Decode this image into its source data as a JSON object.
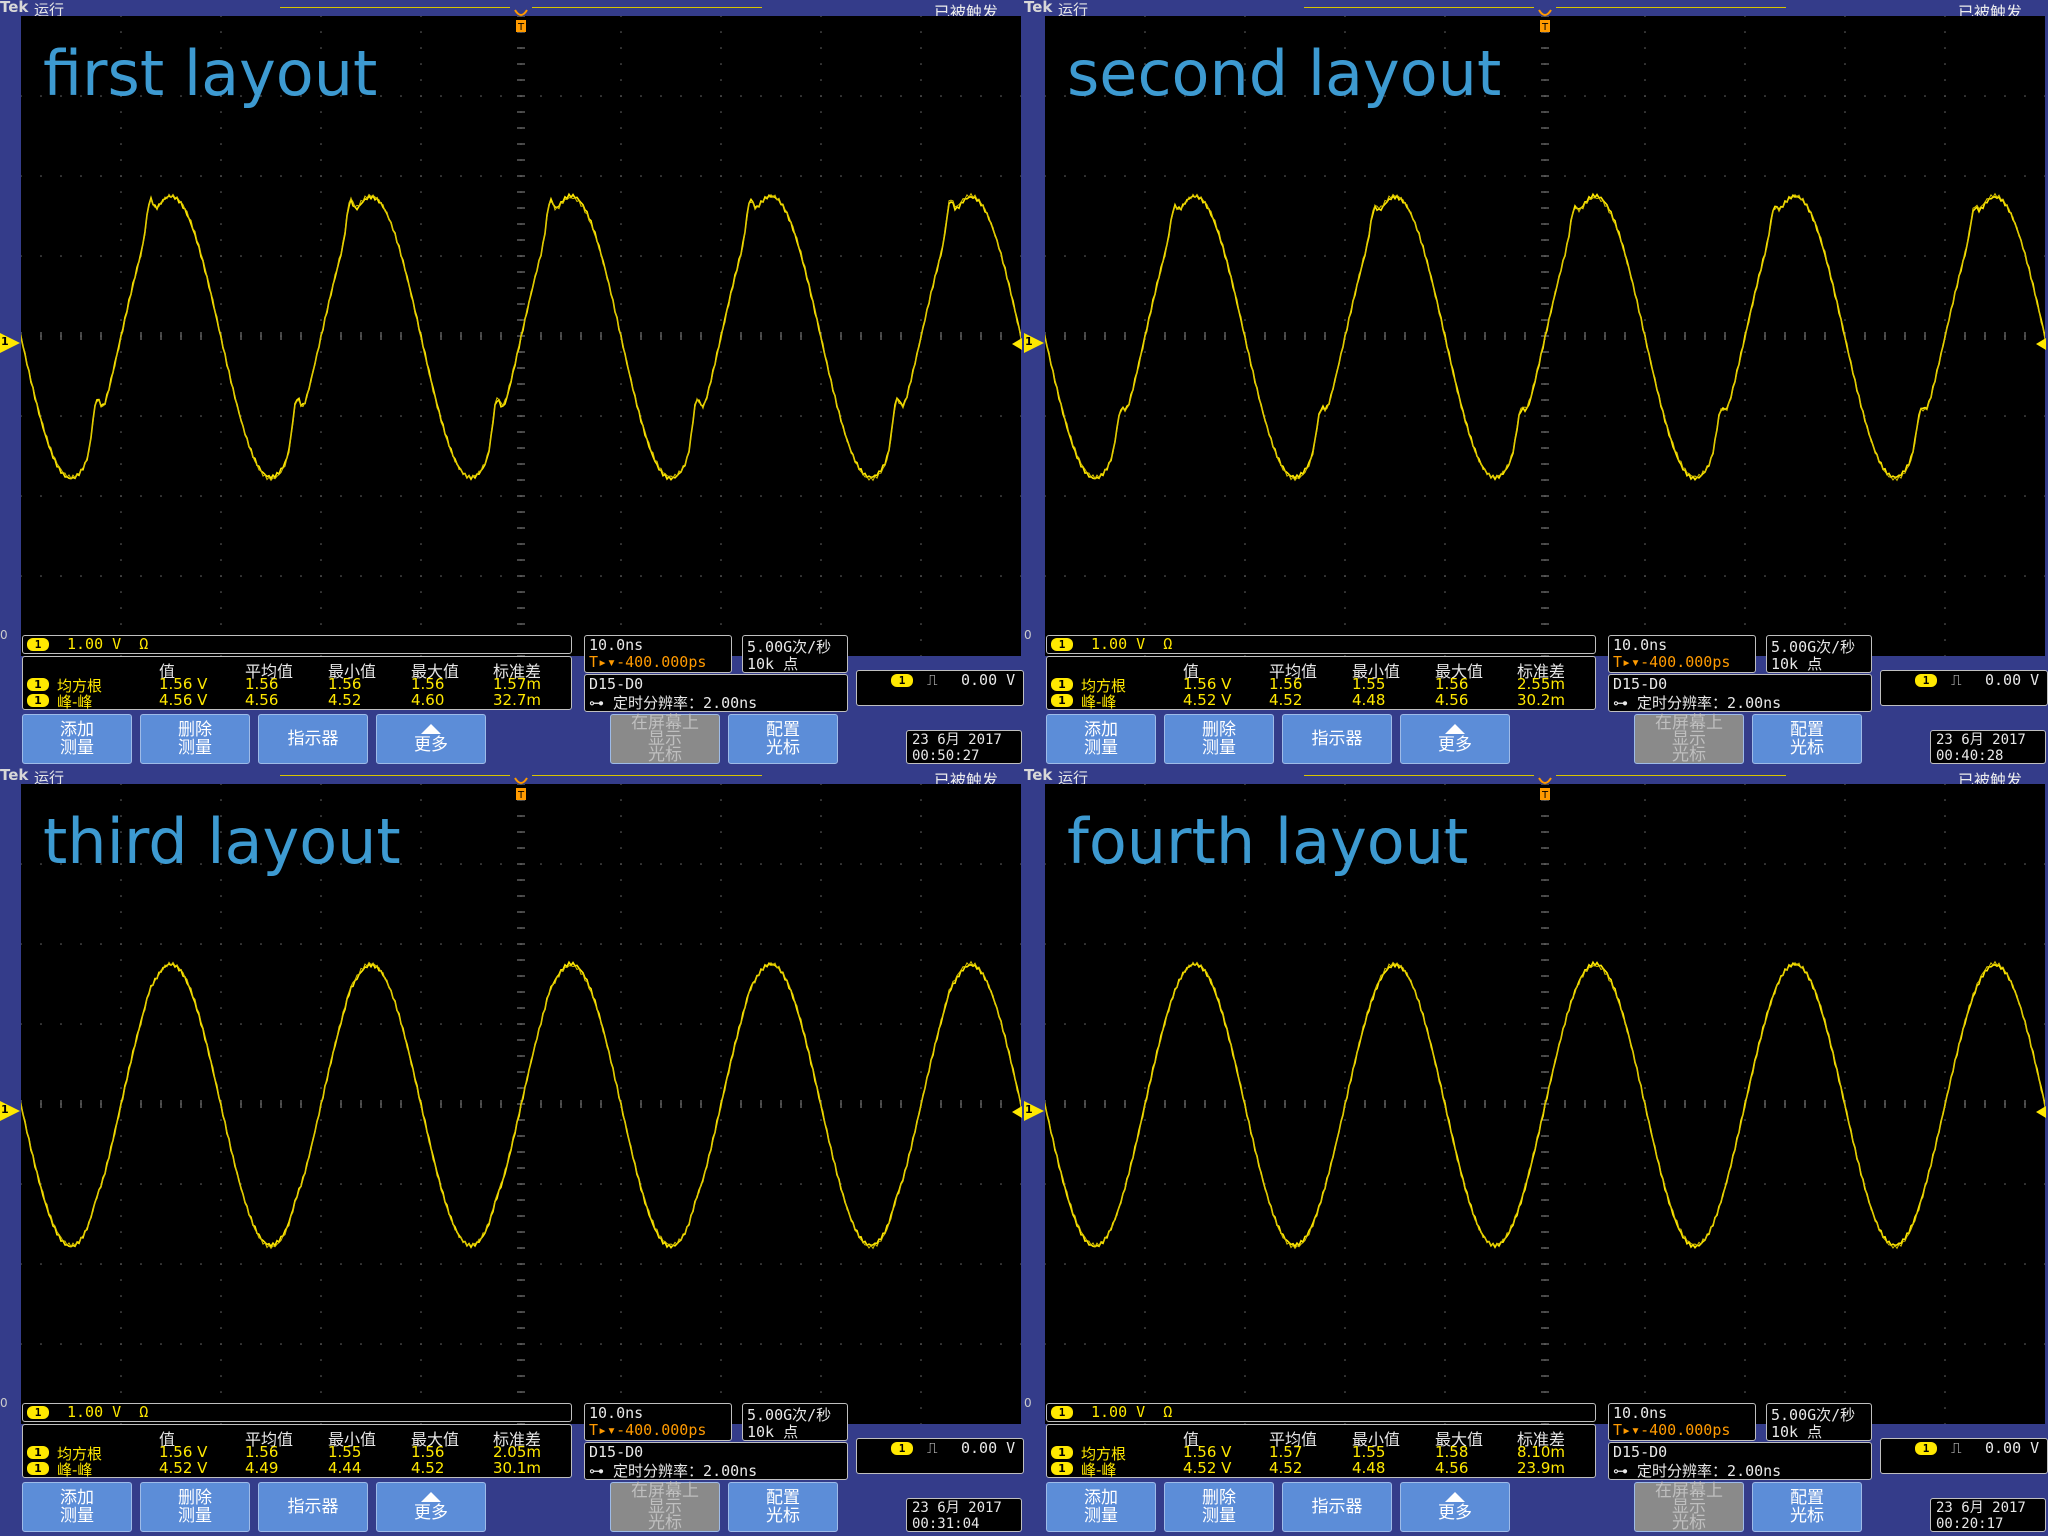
{
  "header": {
    "brand": "Tek",
    "run": "运行",
    "trigger_status": "已被触发"
  },
  "colors": {
    "trace": "#ffe800",
    "title": "#3d9ad1",
    "bezel": "#343c8a",
    "button": "#5c8dd8"
  },
  "panels": [
    {
      "title": "first layout",
      "channel_scale": "1.00 V",
      "ohm": "Ω",
      "meas_headers": [
        "值",
        "平均值",
        "最小值",
        "最大值",
        "标准差"
      ],
      "rows": [
        {
          "label": "均方根",
          "value": "1.56 V",
          "mean": "1.56",
          "min": "1.56",
          "max": "1.56",
          "std": "1.57m"
        },
        {
          "label": "峰-峰",
          "value": "4.56 V",
          "mean": "4.56",
          "min": "4.52",
          "max": "4.60",
          "std": "32.7m"
        }
      ],
      "timebase": "10.0ns",
      "trig_pos": "-400.000ps",
      "sample_rate": "5.00G次/秒",
      "record_len": "10k 点",
      "bus": "D15-D0",
      "timing_res": "定时分辨率：2.00ns",
      "trig_level": "0.00 V",
      "date": "23 6月 2017",
      "time": "00:50:27",
      "buttons": [
        "添加\n测量",
        "删除\n测量",
        "指示器",
        "更多",
        "在屏幕上\n显示\n光标",
        "配置\n光标"
      ],
      "glitch": 1.0
    },
    {
      "title": "second layout",
      "channel_scale": "1.00 V",
      "ohm": "Ω",
      "meas_headers": [
        "值",
        "平均值",
        "最小值",
        "最大值",
        "标准差"
      ],
      "rows": [
        {
          "label": "均方根",
          "value": "1.56 V",
          "mean": "1.56",
          "min": "1.55",
          "max": "1.56",
          "std": "2.55m"
        },
        {
          "label": "峰-峰",
          "value": "4.52 V",
          "mean": "4.52",
          "min": "4.48",
          "max": "4.56",
          "std": "30.2m"
        }
      ],
      "timebase": "10.0ns",
      "trig_pos": "-400.000ps",
      "sample_rate": "5.00G次/秒",
      "record_len": "10k 点",
      "bus": "D15-D0",
      "timing_res": "定时分辨率：2.00ns",
      "trig_level": "0.00 V",
      "date": "23 6月 2017",
      "time": "00:40:28",
      "buttons": [
        "添加\n测量",
        "删除\n测量",
        "指示器",
        "更多",
        "在屏幕上\n显示\n光标",
        "配置\n光标"
      ],
      "glitch": 0.7
    },
    {
      "title": "third layout",
      "channel_scale": "1.00 V",
      "ohm": "Ω",
      "meas_headers": [
        "值",
        "平均值",
        "最小值",
        "最大值",
        "标准差"
      ],
      "rows": [
        {
          "label": "均方根",
          "value": "1.56 V",
          "mean": "1.56",
          "min": "1.55",
          "max": "1.56",
          "std": "2.05m"
        },
        {
          "label": "峰-峰",
          "value": "4.52 V",
          "mean": "4.49",
          "min": "4.44",
          "max": "4.52",
          "std": "30.1m"
        }
      ],
      "timebase": "10.0ns",
      "trig_pos": "-400.000ps",
      "sample_rate": "5.00G次/秒",
      "record_len": "10k 点",
      "bus": "D15-D0",
      "timing_res": "定时分辨率：2.00ns",
      "trig_level": "0.00 V",
      "date": "23 6月 2017",
      "time": "00:31:04",
      "buttons": [
        "添加\n测量",
        "删除\n测量",
        "指示器",
        "更多",
        "在屏幕上\n显示\n光标",
        "配置\n光标"
      ],
      "glitch": 0.15
    },
    {
      "title": "fourth layout",
      "channel_scale": "1.00 V",
      "ohm": "Ω",
      "meas_headers": [
        "值",
        "平均值",
        "最小值",
        "最大值",
        "标准差"
      ],
      "rows": [
        {
          "label": "均方根",
          "value": "1.56 V",
          "mean": "1.57",
          "min": "1.55",
          "max": "1.58",
          "std": "8.10m"
        },
        {
          "label": "峰-峰",
          "value": "4.52 V",
          "mean": "4.52",
          "min": "4.48",
          "max": "4.56",
          "std": "23.9m"
        }
      ],
      "timebase": "10.0ns",
      "trig_pos": "-400.000ps",
      "sample_rate": "5.00G次/秒",
      "record_len": "10k 点",
      "bus": "D15-D0",
      "timing_res": "定时分辨率：2.00ns",
      "trig_level": "0.00 V",
      "date": "23 6月 2017",
      "time": "00:20:17",
      "buttons": [
        "添加\n测量",
        "删除\n测量",
        "指示器",
        "更多",
        "在屏幕上\n显示\n光标",
        "配置\n光标"
      ],
      "glitch": 0.0
    }
  ],
  "waveform": {
    "channel": "1",
    "cycles_visible": 5,
    "amplitude_div": 1.45
  }
}
